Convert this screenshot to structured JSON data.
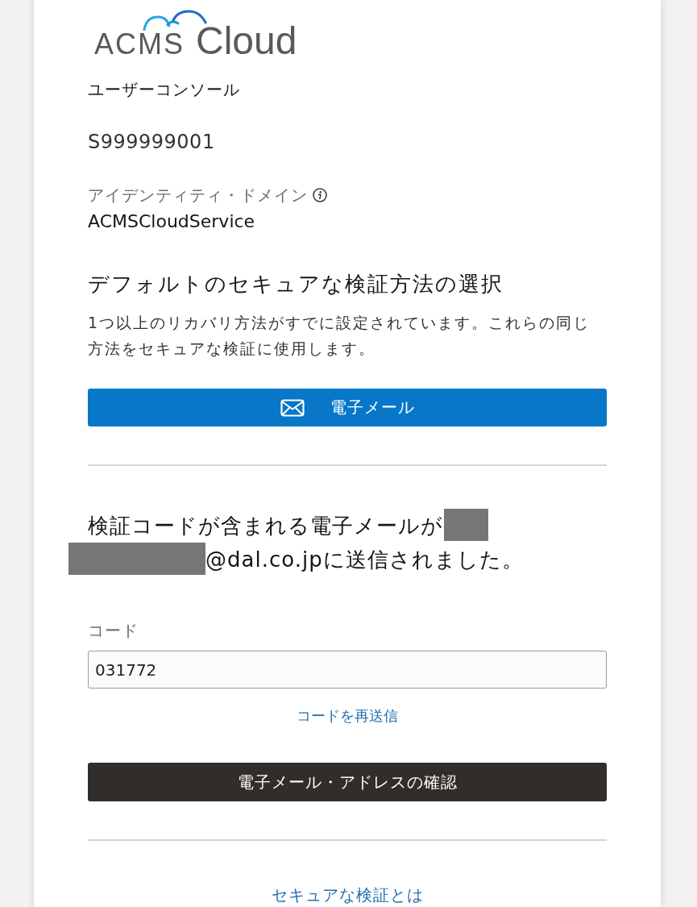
{
  "logo": {
    "brand": "ACMS",
    "product": "Cloud"
  },
  "console_title": "ユーザーコンソール",
  "account_id": "S999999001",
  "identity_domain": {
    "label": "アイデンティティ・ドメイン",
    "value": "ACMSCloudService"
  },
  "method_section": {
    "heading": "デフォルトのセキュアな検証方法の選択",
    "description": "1つ以上のリカバリ方法がすでに設定されています。これらの同じ方法をセキュアな検証に使用します。",
    "methods": [
      {
        "label": "電子メール",
        "kind": "email"
      }
    ]
  },
  "message": {
    "before": "検証コードが含まれる電子メールが",
    "after": "@dal.co.jpに送信されました。"
  },
  "code_field": {
    "label": "コード",
    "value": "031772"
  },
  "resend_link": "コードを再送信",
  "verify_button": "電子メール・アドレスの確認",
  "help_link": "セキュアな検証とは"
}
